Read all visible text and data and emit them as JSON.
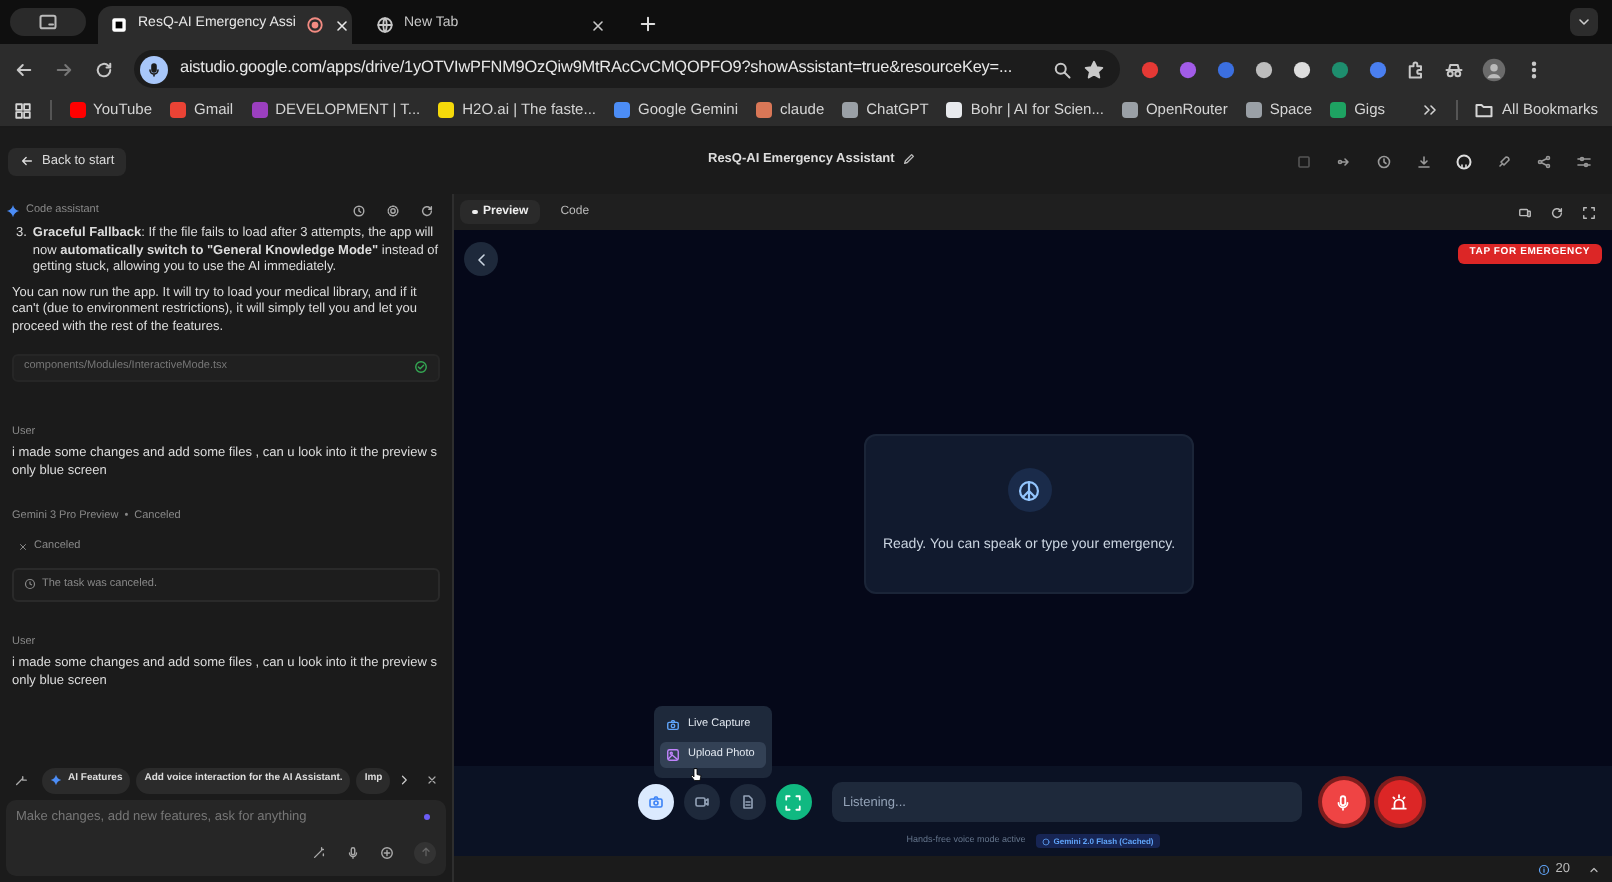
{
  "browser": {
    "tabs": [
      {
        "title": "ResQ-AI Emergency Assi",
        "selected": true
      },
      {
        "title": "New Tab",
        "selected": false
      }
    ],
    "url": "aistudio.google.com/apps/drive/1yOTVIwPFNM9OzQiw9MtRAcCvCMQOPFO9?showAssistant=true&resourceKey=...",
    "bookmarks": [
      {
        "label": "YouTube",
        "color": "#ff0000"
      },
      {
        "label": "Gmail",
        "color": "#ea4335"
      },
      {
        "label": "DEVELOPMENT | T...",
        "color": "#9b3fbf"
      },
      {
        "label": "H2O.ai | The faste...",
        "color": "#f5d90a"
      },
      {
        "label": "Google Gemini",
        "color": "#4c8df6"
      },
      {
        "label": "claude",
        "color": "#d97757"
      },
      {
        "label": "ChatGPT",
        "color": "#9aa0a6"
      },
      {
        "label": "Bohr | AI for Scien...",
        "color": "#e8eaed"
      },
      {
        "label": "OpenRouter",
        "color": "#9aa0a6"
      },
      {
        "label": "Space",
        "color": "#9aa0a6"
      },
      {
        "label": "Gigs",
        "color": "#1ea362"
      }
    ],
    "all_bookmarks": "All Bookmarks"
  },
  "header": {
    "back": "Back to start",
    "title": "ResQ-AI Emergency Assistant"
  },
  "assistant": {
    "title": "Code assistant",
    "messages": [
      {
        "kind": "step",
        "number": "3.",
        "text": "**Graceful Fallback**: If the file fails to load after 3 attempts, the app will now **automatically switch to \"General Knowledge Mode\"** instead of getting stuck, allowing you to use the AI immediately."
      },
      {
        "kind": "paragraph",
        "text": "You can now run the app. It will try to load your medical library, and if it can't (due to environment restrictions), it will simply tell you and let you proceed with the rest of the features."
      },
      {
        "kind": "file",
        "text": "components/Modules/InteractiveMode.tsx",
        "done": true
      },
      {
        "kind": "user",
        "author": "User",
        "text": "i made some changes and add some files , can u look into it the preview s only blue screen"
      },
      {
        "kind": "model",
        "model": "Gemini 3 Pro Preview",
        "separator": "•",
        "status": "Canceled"
      },
      {
        "kind": "canceled",
        "text": "Canceled"
      },
      {
        "kind": "notice",
        "text": "The task was canceled."
      },
      {
        "kind": "user",
        "author": "User",
        "text": "i made some changes and add some files , can u look into it the preview s only blue screen"
      }
    ],
    "suggestions": [
      {
        "kind": "tag",
        "label": "AI Features"
      },
      {
        "kind": "chip",
        "label": "Add voice interaction for the AI Assistant."
      },
      {
        "kind": "chip",
        "label": "Imp"
      }
    ],
    "input": {
      "placeholder": "Make changes, add new features, ask for anything"
    }
  },
  "preview": {
    "tabs": [
      {
        "label": "Preview",
        "selected": true
      },
      {
        "label": "Code",
        "selected": false
      }
    ],
    "emergency_button": "TAP FOR EMERGENCY",
    "status_card": "Ready. You can speak or type your emergency.",
    "attach_menu": [
      {
        "label": "Live Capture",
        "selected": false
      },
      {
        "label": "Upload Photo",
        "selected": true
      }
    ],
    "tools": [
      {
        "kind": "camera",
        "selected": true
      },
      {
        "kind": "video",
        "selected": false
      },
      {
        "kind": "document",
        "selected": false
      },
      {
        "kind": "scan",
        "selected": false
      }
    ],
    "input": {
      "placeholder": "Listening..."
    },
    "hint": "Hands-free voice mode active",
    "model_badge": "Gemini 2.0 Flash (Cached)"
  },
  "status_bar": {
    "count": "20"
  }
}
